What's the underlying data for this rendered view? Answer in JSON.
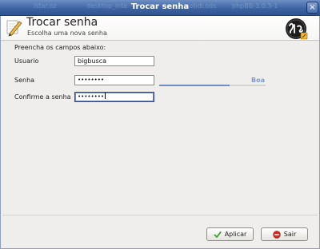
{
  "window": {
    "title": "Trocar senha",
    "background_titles": [
      "istar.oz",
      "desktop_inte",
      "cobdi.ods",
      "phpBB-3.0.3-1"
    ],
    "close_glyph": "×"
  },
  "header": {
    "title": "Trocar senha",
    "subtitle": "Escolha uma nova senha",
    "icon": "edit-pencil-icon",
    "logo": "big-logo"
  },
  "form": {
    "instructions": "Preencha os campos abaixo:",
    "username": {
      "label": "Usuario",
      "value": "bigbusca"
    },
    "password": {
      "label": "Senha",
      "value": "••••••••"
    },
    "confirm": {
      "label": "Confirme a senha",
      "value": "••••••••"
    }
  },
  "strength": {
    "label": "Boa",
    "level_fraction": 0.66
  },
  "buttons": {
    "apply": {
      "label": "Aplicar",
      "icon": "check-icon"
    },
    "quit": {
      "label": "Sair",
      "icon": "stop-icon"
    }
  },
  "colors": {
    "titlebar": "#3e64a3",
    "accent": "#6f8fc2",
    "apply_icon": "#3a9a2c",
    "quit_icon": "#d22a20"
  }
}
